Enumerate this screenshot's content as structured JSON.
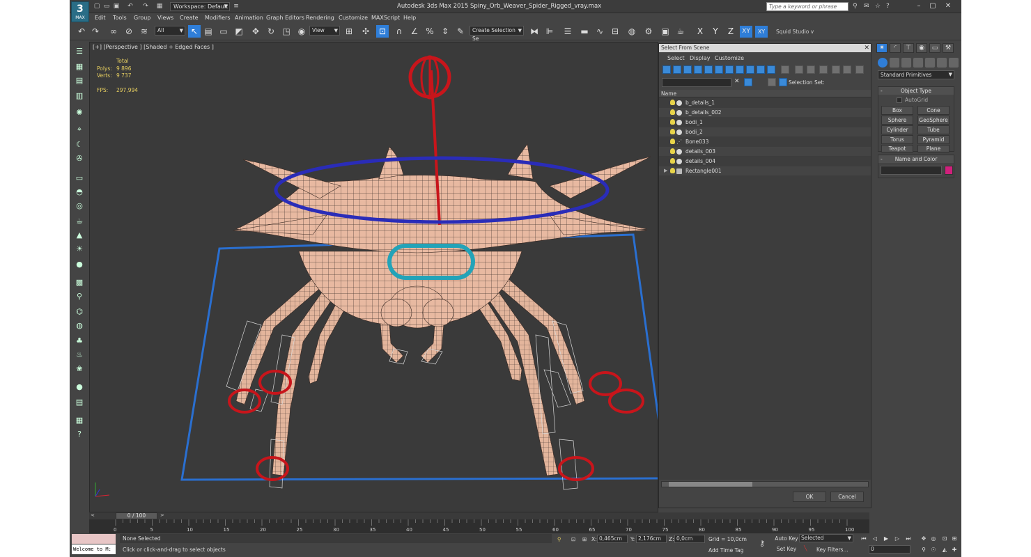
{
  "app": {
    "logo_label": "MAX",
    "title": "Autodesk 3ds Max  2015      Spiny_Orb_Weaver_Spider_Rigged_vray.max",
    "workspace": "Workspace: Default",
    "search_placeholder": "Type a keyword or phrase"
  },
  "menu": [
    "Edit",
    "Tools",
    "Group",
    "Views",
    "Create",
    "Modifiers",
    "Animation",
    "Graph Editors",
    "Rendering",
    "Customize",
    "MAXScript",
    "Help"
  ],
  "toolbar": {
    "filter": "All",
    "ref_coord": "View",
    "selection_set": "Create Selection Se",
    "axes": [
      "X",
      "Y",
      "Z",
      "XY",
      "XY"
    ],
    "studio": "Squid Studio v"
  },
  "viewport": {
    "label": "[+] [Perspective ] [Shaded + Edged Faces ]",
    "stats": {
      "total_label": "Total",
      "polys_label": "Polys:",
      "polys": "9 896",
      "verts_label": "Verts:",
      "verts": "9 737",
      "fps_label": "FPS:",
      "fps": "297,994"
    }
  },
  "dialog": {
    "title": "Select From Scene",
    "menu": [
      "Select",
      "Display",
      "Customize"
    ],
    "selection_set_label": "Selection Set:",
    "column_name": "Name",
    "objects": [
      "b_details_1",
      "b_details_002",
      "bodi_1",
      "bodi_2",
      "Bone033",
      "details_003",
      "details_004",
      "Rectangle001"
    ],
    "ok": "OK",
    "cancel": "Cancel"
  },
  "command_panel": {
    "category": "Standard Primitives",
    "object_type_title": "Object Type",
    "autogrid": "AutoGrid",
    "primitives": [
      "Box",
      "Cone",
      "Sphere",
      "GeoSphere",
      "Cylinder",
      "Tube",
      "Torus",
      "Pyramid",
      "Teapot",
      "Plane"
    ],
    "name_color_title": "Name and Color",
    "swatch_color": "#d0207c"
  },
  "timeline": {
    "slider": "0 / 100",
    "ticks": [
      "0",
      "5",
      "10",
      "15",
      "20",
      "25",
      "30",
      "35",
      "40",
      "45",
      "50",
      "55",
      "60",
      "65",
      "70",
      "75",
      "80",
      "85",
      "90",
      "95",
      "100"
    ]
  },
  "status": {
    "maxscript_output": "Welcome to M:",
    "selected": "None Selected",
    "prompt": "Click or click-and-drag to select objects",
    "x_label": "X:",
    "x": "0,465cm",
    "y_label": "Y:",
    "y": "2,176cm",
    "z_label": "Z:",
    "z": "0,0cm",
    "grid": "Grid = 10,0cm",
    "add_time_tag": "Add Time Tag",
    "auto_key": "Auto Key",
    "set_key": "Set Key",
    "key_mode": "Selected",
    "key_filters": "Key Filters...",
    "frame": "0"
  }
}
